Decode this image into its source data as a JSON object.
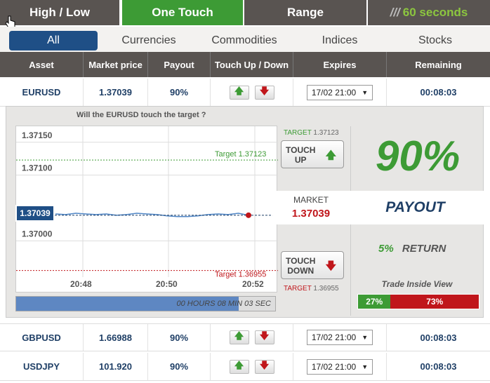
{
  "tabs": [
    {
      "label": "High / Low"
    },
    {
      "label": "One Touch"
    },
    {
      "label": "Range"
    },
    {
      "label": "60 seconds",
      "prefix": "///"
    }
  ],
  "subtabs": [
    "All",
    "Currencies",
    "Commodities",
    "Indices",
    "Stocks"
  ],
  "columns": [
    "Asset",
    "Market price",
    "Payout",
    "Touch Up / Down",
    "Expires",
    "Remaining"
  ],
  "rows": [
    {
      "asset": "EURUSD",
      "price": "1.37039",
      "payout": "90%",
      "expires": "17/02 21:00",
      "remaining": "00:08:03"
    },
    {
      "asset": "GBPUSD",
      "price": "1.66988",
      "payout": "90%",
      "expires": "17/02 21:00",
      "remaining": "00:08:03"
    },
    {
      "asset": "USDJPY",
      "price": "101.920",
      "payout": "90%",
      "expires": "17/02 21:00",
      "remaining": "00:08:03"
    }
  ],
  "panel": {
    "question": "Will the EURUSD touch the target ?",
    "target_up_label": "TARGET",
    "target_up": "1.37123",
    "target_down_label": "TARGET",
    "target_down": "1.36955",
    "touch_up_line1": "TOUCH",
    "touch_up_line2": "UP",
    "touch_down_line1": "TOUCH",
    "touch_down_line2": "DOWN",
    "market_label": "MARKET",
    "market_value": "1.37039",
    "payout_pct": "90%",
    "payout_label": "PAYOUT",
    "return_pct": "5%",
    "return_label": "RETURN",
    "trade_inside": "Trade Inside View",
    "up_pct": "27%",
    "down_pct": "73%",
    "up_share": 0.27,
    "countdown": "00 HOURS 08 MIN 03 SEC",
    "countdown_progress": 0.86,
    "colors": {
      "up": "#3d9b35",
      "down": "#c0161b",
      "accent": "#1f4f86"
    }
  },
  "chart_data": {
    "type": "line",
    "yticks": [
      "1.37150",
      "1.37100",
      "1.37000"
    ],
    "xticks": [
      "20:48",
      "20:50",
      "20:52"
    ],
    "target_up_label": "Target 1.37123",
    "target_down_label": "Target 1.36955",
    "current_label": "1.37039",
    "y_values": [
      1.37041,
      1.3704,
      1.37042,
      1.37041,
      1.3704,
      1.37041,
      1.37039,
      1.3704,
      1.37042,
      1.37041,
      1.3704,
      1.37038,
      1.37037,
      1.37037,
      1.37038,
      1.3704,
      1.37041,
      1.3704,
      1.37042,
      1.37039
    ],
    "ylim": [
      1.36945,
      1.3717
    ]
  }
}
